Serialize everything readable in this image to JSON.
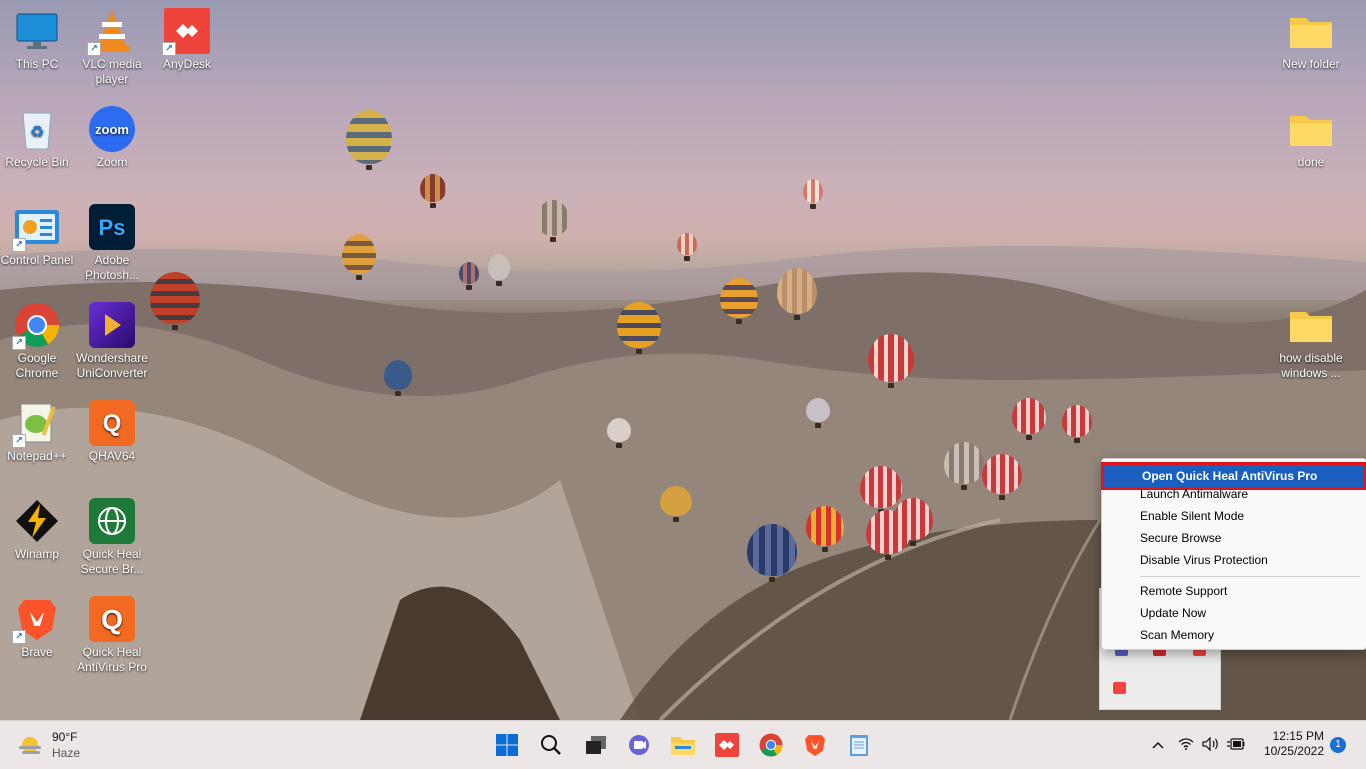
{
  "desktop_icons": [
    {
      "label": "This PC"
    },
    {
      "label": "VLC media player"
    },
    {
      "label": "AnyDesk"
    },
    {
      "label": "Recycle Bin"
    },
    {
      "label": "Zoom"
    },
    {
      "label": "Control Panel"
    },
    {
      "label": "Adobe Photosh..."
    },
    {
      "label": "Google Chrome"
    },
    {
      "label": "Wondershare UniConverter"
    },
    {
      "label": "Notepad++"
    },
    {
      "label": "QHAV64"
    },
    {
      "label": "Winamp"
    },
    {
      "label": "Quick Heal Secure Br..."
    },
    {
      "label": "Brave"
    },
    {
      "label": "Quick Heal AntiVirus Pro"
    },
    {
      "label": "New folder"
    },
    {
      "label": "done"
    },
    {
      "label": "how disable windows ..."
    }
  ],
  "icon_texts": {
    "zoom": "zoom",
    "ps": "Ps",
    "qh": "Q"
  },
  "context_menu": {
    "items": [
      {
        "label": "Open Quick Heal AntiVirus Pro",
        "highlighted": true
      },
      {
        "label": "Launch Antimalware"
      },
      {
        "label": "Enable Silent Mode"
      },
      {
        "label": "Secure Browse"
      },
      {
        "label": "Disable Virus Protection"
      },
      {
        "label": "Remote Support"
      },
      {
        "label": "Update Now"
      },
      {
        "label": "Scan Memory"
      }
    ],
    "highlight_color": "#1a5fbf",
    "outline_color": "#e0141e"
  },
  "taskbar": {
    "weather_temp": "90°F",
    "weather_desc": "Haze",
    "pinned": [
      "start-icon",
      "search-icon",
      "task-view-icon",
      "chat-icon",
      "file-explorer-icon",
      "anydesk-icon",
      "chrome-icon",
      "brave-icon",
      "notepad-icon"
    ],
    "clock_time": "12:15 PM",
    "clock_date": "10/25/2022",
    "notification_count": "1"
  }
}
